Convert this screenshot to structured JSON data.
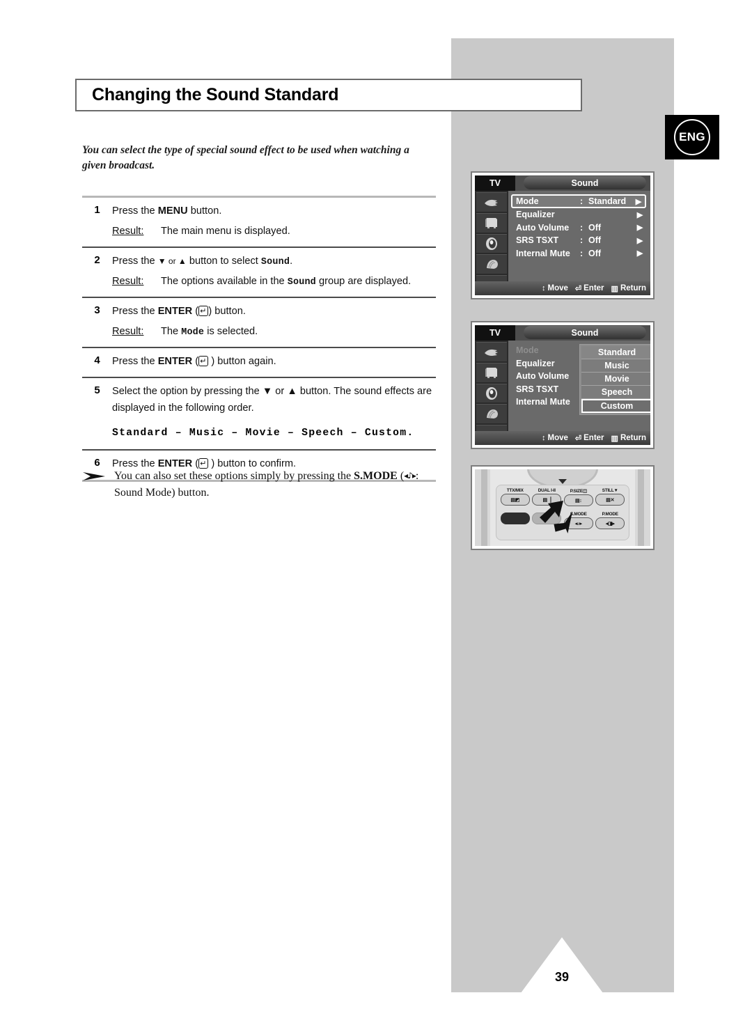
{
  "page": {
    "title": "Changing the Sound Standard",
    "language_badge": "ENG",
    "page_number": "39",
    "intro": "You can select the type of special sound effect to be used when watching a given broadcast."
  },
  "steps": [
    {
      "num": "1",
      "instruction_pre": "Press the ",
      "instruction_bold": "MENU",
      "instruction_post": " button.",
      "result_label": "Result:",
      "result_text": "The main menu is displayed."
    },
    {
      "num": "2",
      "instruction_pre": "Press the ",
      "instruction_bold": "▼ or ▲",
      "instruction_post": " button to select ",
      "instruction_mono": "Sound",
      "instruction_tail": ".",
      "result_label": "Result:",
      "result_pre": "The options available in the ",
      "result_mono": "Sound",
      "result_post": " group are displayed."
    },
    {
      "num": "3",
      "instruction_pre": "Press the ",
      "instruction_bold": "ENTER",
      "instruction_post": " button.",
      "key_glyph": "enter-key",
      "result_label": "Result:",
      "result_pre": "The ",
      "result_mono": "Mode",
      "result_post": " is selected."
    },
    {
      "num": "4",
      "instruction_pre": "Press the ",
      "instruction_bold": "ENTER",
      "instruction_post": " button again.",
      "key_glyph": "enter-key"
    },
    {
      "num": "5",
      "instruction_full": "Select the option by pressing the ▼ or ▲ button. The sound effects are displayed in the following order.",
      "order_line": "Standard – Music – Movie – Speech – Custom."
    },
    {
      "num": "6",
      "instruction_pre": "Press the ",
      "instruction_bold": "ENTER",
      "instruction_post": " button to confirm.",
      "key_glyph": "enter-key"
    }
  ],
  "note": {
    "arrow_icon": "note-arrow-icon",
    "text_pre": "You can also set these options simply by pressing the ",
    "bold": "S.MODE",
    "paren_open": " (",
    "glyph": "◂♪▸",
    "paren_text": ": Sound Mode) button.",
    "full": "You can also set these options simply by pressing the S.MODE ( : Sound Mode) button."
  },
  "osd_menus": [
    {
      "id": "sound-menu-default",
      "tv_label": "TV",
      "title": "Sound",
      "sidebar_icons": [
        "input-source-icon",
        "picture-icon",
        "sound-icon",
        "features-icon",
        "setup-icon"
      ],
      "rows": [
        {
          "label": "Mode",
          "colon": ":",
          "value": "Standard",
          "arrow": "▶",
          "selected": true
        },
        {
          "label": "Equalizer",
          "colon": "",
          "value": "",
          "arrow": "▶",
          "selected": false
        },
        {
          "label": "Auto Volume",
          "colon": ":",
          "value": "Off",
          "arrow": "▶",
          "selected": false
        },
        {
          "label": "SRS TSXT",
          "colon": ":",
          "value": "Off",
          "arrow": "▶",
          "selected": false
        },
        {
          "label": "Internal Mute",
          "colon": ":",
          "value": "Off",
          "arrow": "▶",
          "selected": false
        }
      ],
      "footer": [
        {
          "icon": "↕",
          "label": "Move"
        },
        {
          "icon": "⏎",
          "label": "Enter"
        },
        {
          "icon": "▥",
          "label": "Return"
        }
      ]
    },
    {
      "id": "sound-menu-mode-open",
      "tv_label": "TV",
      "title": "Sound",
      "sidebar_icons": [
        "input-source-icon",
        "picture-icon",
        "sound-icon",
        "features-icon",
        "setup-icon"
      ],
      "rows": [
        {
          "label": "Mode",
          "colon": ":",
          "value": "",
          "arrow": "",
          "selected": false,
          "dim": true
        },
        {
          "label": "Equalizer",
          "colon": "",
          "value": "",
          "arrow": "",
          "selected": false
        },
        {
          "label": "Auto Volume",
          "colon": ":",
          "value": "",
          "arrow": "",
          "selected": false
        },
        {
          "label": "SRS TSXT",
          "colon": ":",
          "value": "",
          "arrow": "",
          "selected": false
        },
        {
          "label": "Internal Mute",
          "colon": ":",
          "value": "",
          "arrow": "",
          "selected": false
        }
      ],
      "dropdown": {
        "options": [
          "Standard",
          "Music",
          "Movie",
          "Speech",
          "Custom"
        ],
        "selected": "Custom"
      },
      "footer": [
        {
          "icon": "↕",
          "label": "Move"
        },
        {
          "icon": "⏎",
          "label": "Enter"
        },
        {
          "icon": "▥",
          "label": "Return"
        }
      ]
    }
  ],
  "remote": {
    "buttons_row1": [
      {
        "label": "TTX/MIX",
        "glyph": "▤◩"
      },
      {
        "label": "DUAL I-II",
        "glyph": "▤▕"
      },
      {
        "label": "P.SIZE",
        "glyph": "▤↕",
        "label_glyph": "◫"
      },
      {
        "label": "STILL",
        "glyph": "▤✕",
        "label_glyph": "▼"
      }
    ],
    "buttons_row2": [
      {
        "label": "",
        "glyph": ""
      },
      {
        "label": "",
        "glyph": ""
      },
      {
        "label": "S.MODE",
        "glyph": "◂♪▸"
      },
      {
        "label": "P.MODE",
        "glyph": "◂◨▸"
      }
    ],
    "highlight": "s-mode-button"
  },
  "colors": {
    "panel_grey": "#c9c9c9",
    "osd_grey": "#6a6a6a",
    "badge_black": "#000000",
    "rule_grey": "#b8b8b8"
  }
}
